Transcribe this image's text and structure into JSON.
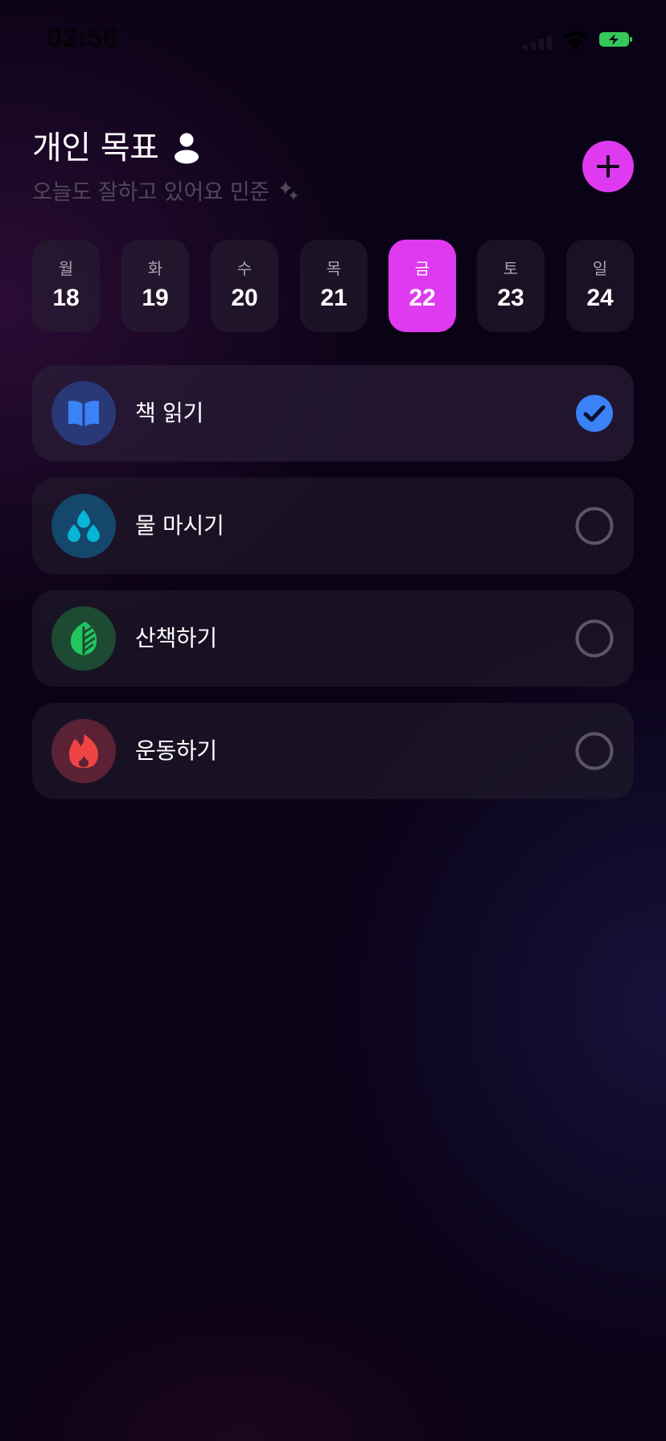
{
  "status_bar": {
    "time": "02:56",
    "battery_color": "#34c759"
  },
  "header": {
    "title": "개인 목표",
    "subtitle": "오늘도 잘하고 있어요 민준",
    "add_icon": "plus-icon",
    "accent_color": "#df3af0"
  },
  "days": [
    {
      "weekday": "월",
      "date": "18",
      "selected": false
    },
    {
      "weekday": "화",
      "date": "19",
      "selected": false
    },
    {
      "weekday": "수",
      "date": "20",
      "selected": false
    },
    {
      "weekday": "목",
      "date": "21",
      "selected": false
    },
    {
      "weekday": "금",
      "date": "22",
      "selected": true
    },
    {
      "weekday": "토",
      "date": "23",
      "selected": false
    },
    {
      "weekday": "일",
      "date": "24",
      "selected": false
    }
  ],
  "goals": [
    {
      "label": "책 읽기",
      "icon": "book-icon",
      "color": "#3b82f6",
      "done": true
    },
    {
      "label": "물 마시기",
      "icon": "water-drops-icon",
      "color": "#06b6d4",
      "done": false
    },
    {
      "label": "산책하기",
      "icon": "leaf-icon",
      "color": "#22c55e",
      "done": false
    },
    {
      "label": "운동하기",
      "icon": "flame-icon",
      "color": "#ef4444",
      "done": false
    }
  ]
}
